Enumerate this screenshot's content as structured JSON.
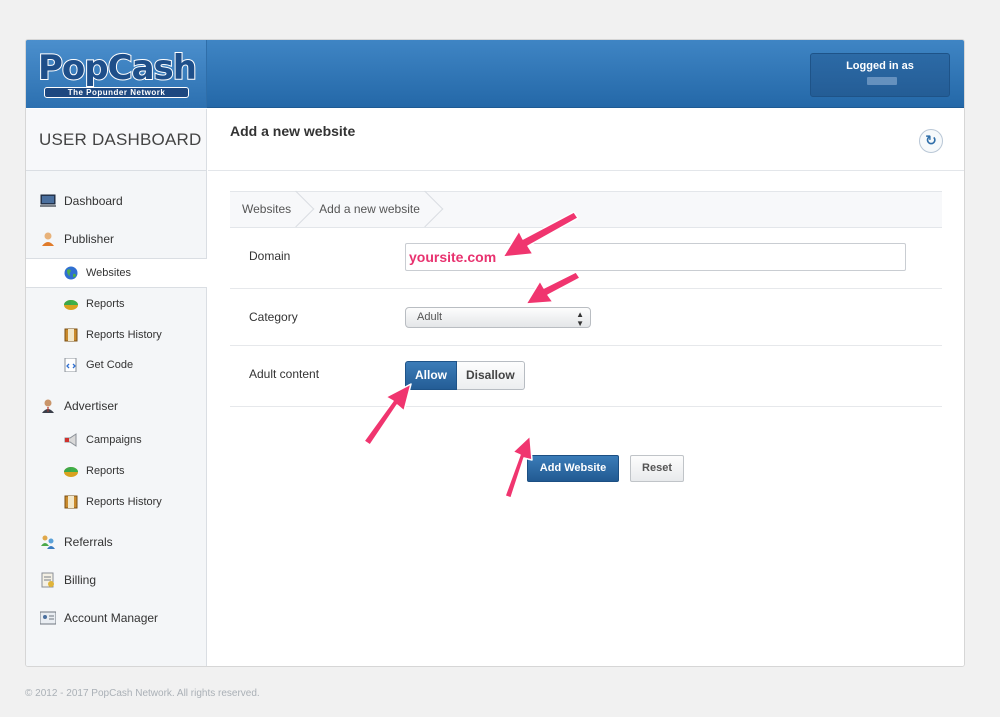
{
  "brand": {
    "logo_text": "PopCash",
    "tagline": "The Popunder Network"
  },
  "header": {
    "logged_in_label": "Logged in as"
  },
  "sidebar": {
    "title": "USER DASHBOARD",
    "items": [
      {
        "label": "Dashboard",
        "icon": "monitor-icon"
      },
      {
        "label": "Publisher",
        "icon": "user-icon"
      },
      {
        "label": "Websites",
        "icon": "globe-icon",
        "sub": true,
        "active": true
      },
      {
        "label": "Reports",
        "icon": "chart-icon",
        "sub": true
      },
      {
        "label": "Reports History",
        "icon": "history-icon",
        "sub": true
      },
      {
        "label": "Get Code",
        "icon": "code-icon",
        "sub": true
      },
      {
        "label": "Advertiser",
        "icon": "advertiser-icon"
      },
      {
        "label": "Campaigns",
        "icon": "megaphone-icon",
        "sub": true
      },
      {
        "label": "Reports",
        "icon": "chart-icon",
        "sub": true
      },
      {
        "label": "Reports History",
        "icon": "history-icon",
        "sub": true
      },
      {
        "label": "Referrals",
        "icon": "referrals-icon"
      },
      {
        "label": "Billing",
        "icon": "billing-icon"
      },
      {
        "label": "Account Manager",
        "icon": "account-manager-icon"
      }
    ]
  },
  "main": {
    "title": "Add a new website",
    "breadcrumb": [
      "Websites",
      "Add a new website"
    ],
    "form": {
      "domain_label": "Domain",
      "domain_value": "yoursite.com",
      "category_label": "Category",
      "category_value": "Adult",
      "adult_label": "Adult content",
      "adult_allow": "Allow",
      "adult_disallow": "Disallow",
      "adult_selected": "Allow",
      "submit_label": "Add Website",
      "reset_label": "Reset"
    }
  },
  "footer": {
    "copyright": "© 2012 - 2017 PopCash Network. All rights reserved."
  },
  "colors": {
    "header_blue": "#2e72b1",
    "primary_button": "#2b6aa6",
    "annotation_arrow": "#f0356f"
  }
}
